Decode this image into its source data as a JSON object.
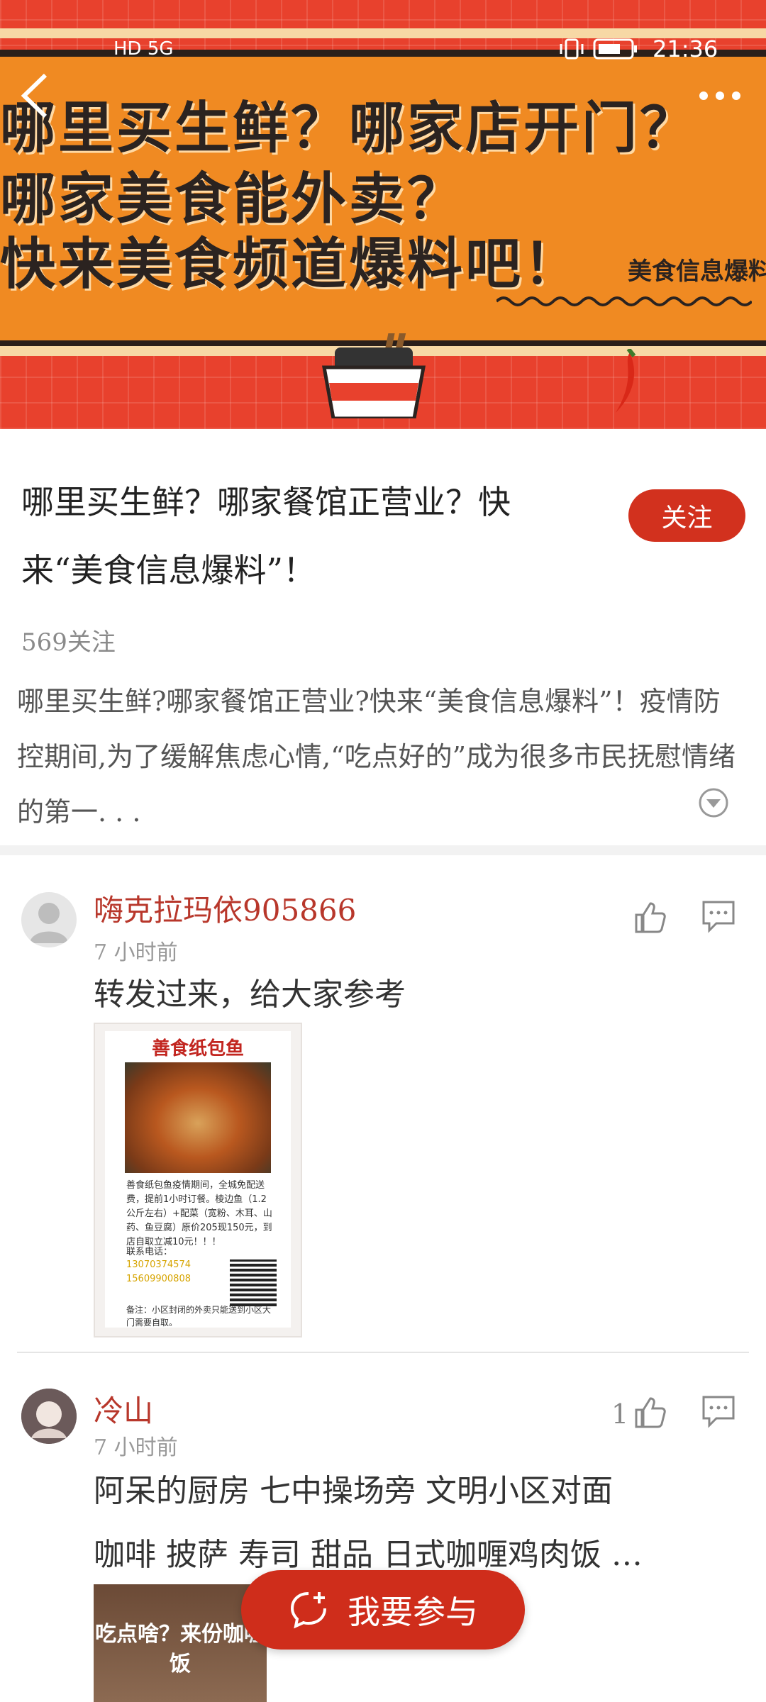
{
  "banner": {
    "line1": "哪里买生鲜？哪家店开门？",
    "line2": "哪家美食能外卖？",
    "line3": "快来美食频道爆料吧！",
    "sub": "美食信息爆料"
  },
  "status_bar": {
    "left": "HD 5G",
    "time": "21:36"
  },
  "topic": {
    "title": "哪里买生鲜？哪家餐馆正营业？快来“美食信息爆料”！",
    "follow_label": "关注",
    "followers": "569关注",
    "description": "哪里买生鲜?哪家餐馆正营业?快来“美食信息爆料”！疫情防控期间,为了缓解焦虑心情,“吃点好的”成为很多市民抚慰情绪的第一. . ."
  },
  "posts": [
    {
      "username": "嗨克拉玛依905866",
      "time": "7  小时前",
      "text": "转发过来，给大家参考",
      "like_count": "",
      "poster": {
        "title": "善食纸包鱼",
        "body": "善食纸包鱼疫情期间，全城免配送费，提前1小时订餐。棱边鱼（1.2公斤左右）+配菜（宽粉、木耳、山药、鱼豆腐）原价205现150元，到店自取立减10元！！！",
        "contact_label": "联系电话：",
        "phone1": "13070374574",
        "phone2": "15609900808",
        "note": "备注：小区封闭的外卖只能送到小区大门需要自取。"
      }
    },
    {
      "username": "冷山",
      "time": "7  小时前",
      "line1": "阿呆的厨房  七中操场旁  文明小区对面",
      "line2": "咖啡  披萨  寿司  甜品  日式咖喱鸡肉饭  …",
      "like_count": "1",
      "thumb_text": "吃点啥？来份咖喱饭"
    }
  ],
  "join_button": "我要参与"
}
